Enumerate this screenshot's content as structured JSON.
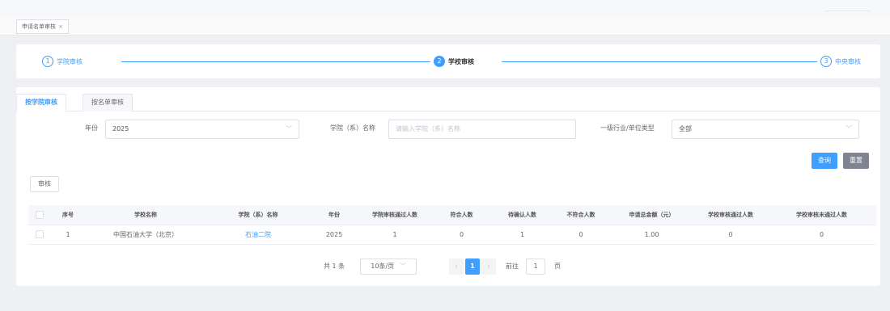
{
  "page_tab": {
    "label": "申请名单审核",
    "close": "×"
  },
  "steps": [
    {
      "number": "1",
      "label": "学院审核"
    },
    {
      "number": "2",
      "label": "学校审核"
    },
    {
      "number": "3",
      "label": "中央审核"
    }
  ],
  "mode_tabs": [
    "按学院审核",
    "按名单审核"
  ],
  "filters": {
    "year_label": "年份",
    "year_value": "2025",
    "college_label": "学院（系）名称",
    "college_placeholder": "请输入学院（系）名称",
    "industry_label": "一级行业/单位类型",
    "industry_value": "全部"
  },
  "buttons": {
    "query": "查询",
    "reset": "重置",
    "audit": "审核"
  },
  "table": {
    "columns": [
      "序号",
      "学校名称",
      "学院（系）名称",
      "年份",
      "学院审核通过人数",
      "符合人数",
      "待确认人数",
      "不符合人数",
      "申请总金额（元）",
      "学校审核通过人数",
      "学校审核未通过人数"
    ],
    "rows": [
      {
        "index": "1",
        "school": "中国石油大学（北京）",
        "college": "石油二院",
        "year": "2025",
        "college_passed": "1",
        "eligible": "0",
        "pending": "1",
        "ineligible": "0",
        "amount": "1.00",
        "school_passed": "0",
        "school_failed": "0"
      }
    ]
  },
  "pagination": {
    "total": "共 1 条",
    "page_size": "10条/页",
    "current_page": "1",
    "goto_label": "前往",
    "goto_value": "1",
    "page_suffix": "页"
  },
  "icons": {
    "dropdown": "chevron-down-icon",
    "prev": "chevron-left-icon",
    "next": "chevron-right-icon"
  },
  "colors": {
    "primary": "#409eff",
    "reset_button": "#7d8590"
  }
}
